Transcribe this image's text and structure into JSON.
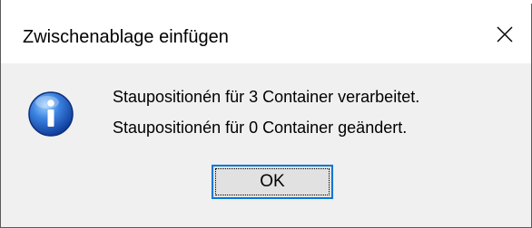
{
  "dialog": {
    "title": "Zwischenablage einfügen",
    "close_icon": "close-icon",
    "info_icon": "information-icon",
    "message_lines": [
      "Staupositionén für 3 Container verarbeitet.",
      "Staupositionén für 0 Container geändert."
    ],
    "ok_label": "OK"
  },
  "colors": {
    "button_focus_border": "#0078d7",
    "dialog_background": "#f0f0f0",
    "titlebar_background": "#ffffff"
  }
}
